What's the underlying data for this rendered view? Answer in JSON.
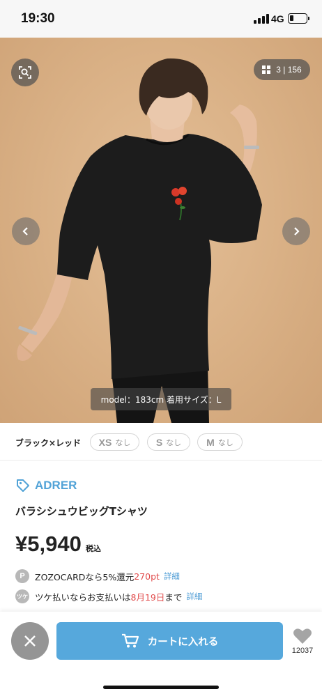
{
  "status_bar": {
    "time": "19:30",
    "network": "4G"
  },
  "gallery": {
    "counter": "3 | 156",
    "caption": "model：183cm 着用サイズ：L",
    "icons": [
      "zoom-icon",
      "grid-icon",
      "chevron-left-icon",
      "chevron-right-icon"
    ]
  },
  "variant": {
    "color_name": "ブラック×レッド",
    "sizes": [
      {
        "label": "XS",
        "stock": "なし"
      },
      {
        "label": "S",
        "stock": "なし"
      },
      {
        "label": "M",
        "stock": "なし"
      }
    ]
  },
  "product": {
    "brand": "ADRER",
    "name": "バラシシュウビッグTシャツ",
    "price": "¥5,940",
    "tax_label": "税込"
  },
  "perks": {
    "zozocard": {
      "badge": "P",
      "text": "ZOZOCARDなら5%還元 ",
      "points": "270pt",
      "link": "詳細"
    },
    "tsuke": {
      "badge": "ツケ",
      "text_before": "ツケ払いならお支払いは",
      "date": "8月19日",
      "text_after": "まで",
      "link": "詳細"
    }
  },
  "actions": {
    "cart_label": "カートに入れる",
    "favorite_count": "12037"
  },
  "colors": {
    "accent_blue": "#56a8dc",
    "brand_blue": "#52a3d7",
    "sale_red": "#e14b4b",
    "image_background": "#dab187"
  }
}
